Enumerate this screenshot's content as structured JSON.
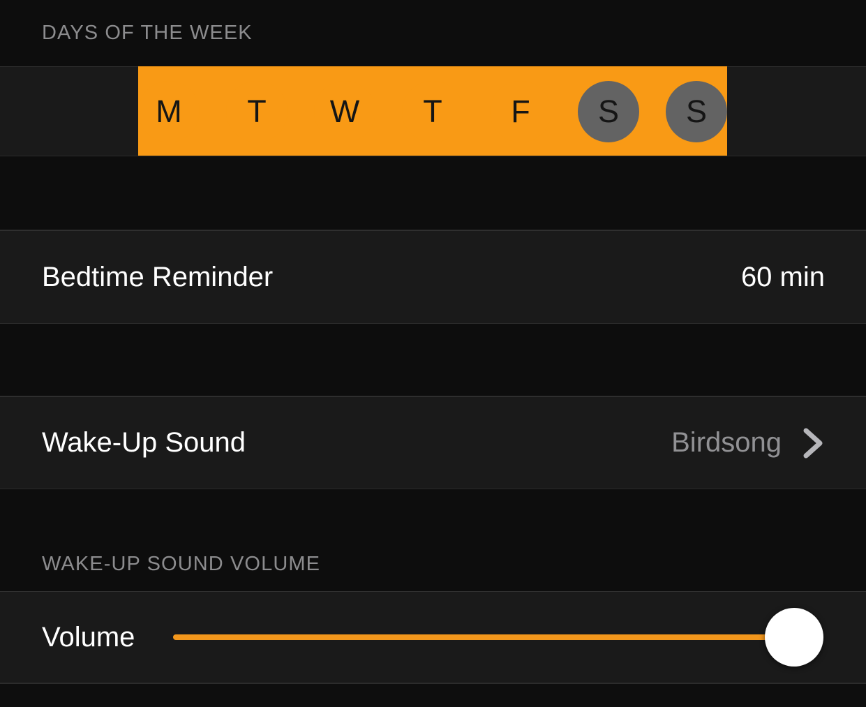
{
  "theme": {
    "accent_orange": "#f99a15",
    "inactive_grey": "#636363",
    "row_background": "#1a1a1a",
    "page_background": "#0d0d0d",
    "primary_text": "#ffffff",
    "secondary_text": "#919194",
    "caption_text": "#8c8c8e",
    "slider_fill": "#f3971c",
    "slider_thumb": "#ffffff"
  },
  "days_section": {
    "header": "DAYS OF THE WEEK",
    "days": [
      {
        "label": "M",
        "name": "monday",
        "selected": true
      },
      {
        "label": "T",
        "name": "tuesday",
        "selected": true
      },
      {
        "label": "W",
        "name": "wednesday",
        "selected": true
      },
      {
        "label": "T",
        "name": "thursday",
        "selected": true
      },
      {
        "label": "F",
        "name": "friday",
        "selected": true
      },
      {
        "label": "S",
        "name": "saturday",
        "selected": true
      },
      {
        "label": "S",
        "name": "sunday",
        "selected": false
      }
    ]
  },
  "bedtime_section": {
    "title": "Bedtime Reminder",
    "value": "60 min"
  },
  "sound_section": {
    "title": "Wake-Up Sound",
    "value": "Birdsong",
    "disclosure_icon": "chevron-right-icon"
  },
  "volume_section": {
    "header": "WAKE-UP SOUND VOLUME",
    "title": "Volume",
    "value_percent": 100
  }
}
